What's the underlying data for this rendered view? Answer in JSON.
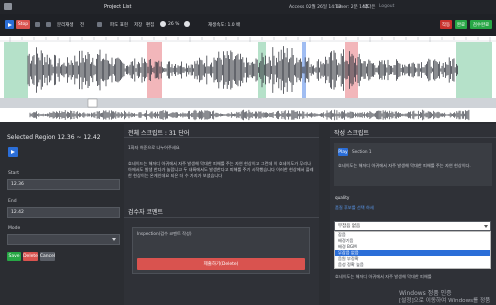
{
  "topbar": {
    "project_list": "Project List",
    "access": "Access 02월 26일 14:13",
    "timer": "Timer: 2분 14초",
    "user": "박다은",
    "logout": "Logout"
  },
  "toolbar": {
    "stop": "Stop",
    "mode_a": "분리재생",
    "mode_b": "전",
    "zoom_label": "파도 표현",
    "save_label": "저장",
    "edit_label": "편집",
    "zoom_value": "26 %",
    "speed_label": "재생속도: 1.0 배",
    "right_btn_1": "작동",
    "right_btn_2": "완료",
    "right_btn_3": "검수완료"
  },
  "left_panel": {
    "title": "Selected Region 12.36 ~ 12.42",
    "start_label": "Start",
    "start_value": "12.36",
    "end_label": "End",
    "end_value": "12.42",
    "mode_label": "Mode",
    "save": "Save",
    "delete": "Delete",
    "cancel": "Cancel"
  },
  "middle_panel": {
    "title": "전체 스크립트 : 31 단어",
    "speaker": "1화자 허준으로 나누어주세요",
    "script": "호네이드는 해저디 아귀에서 자주 발생해 막대한 피해를 주는 자연 현상이고 그런데 이 호네이도가 무리나아에서도 발생 한다가 놀랍니고 두 내륙에서도 발생한다고 피해를 주기 시작했습니다 이러한 현상에서 플레한 현상이는 온게인데요 되은 더 수 가지가 보셨습니다",
    "review_title": "검수자 코멘트",
    "review_field": "Inspection(검수 코멘트 작성)",
    "review_button": "제출하기(Delete)"
  },
  "right_panel": {
    "title": "작성 스크립트",
    "play": "Play",
    "section": "Section 1",
    "script": "호네이도는 해저디 아귀에서 자주 발생해 막대한 피해를 주는 자연 현상이다.",
    "quality_label": "quality",
    "quality_note": "품질 후보를 선택 하세",
    "select_value": "무잡음 없음",
    "options": [
      "잡음",
      "배경기음",
      "배경 BGM",
      "무잡음 없음",
      "음원 부정확",
      "음성 정확 높음"
    ],
    "selected_option": "무잡음 없음",
    "footer": "[설정]으로 이동하여 Windows를 정품 인증합니다.",
    "footer_top": "Windows 정품 인증"
  },
  "colors": {
    "accent": "#2b6ed8",
    "danger": "#c9302c",
    "success": "#27a745",
    "region_green": "#a8dcc0",
    "region_pink": "#f0a9ae",
    "region_blue": "#8fb2f0",
    "wave": "#3c3f47"
  }
}
